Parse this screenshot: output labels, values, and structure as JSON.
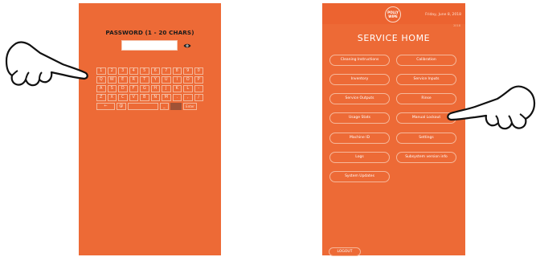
{
  "left_screen": {
    "title": "PASSWORD (1 - 20 CHARS)",
    "password_value": "",
    "keyboard": {
      "row1": [
        "1",
        "2",
        "3",
        "4",
        "5",
        "6",
        "7",
        "8",
        "9",
        "0"
      ],
      "row2": [
        "Q",
        "W",
        "E",
        "R",
        "T",
        "Y",
        "U",
        "I",
        "O",
        "P"
      ],
      "row3": [
        "A",
        "S",
        "D",
        "F",
        "G",
        "H",
        "J",
        "K",
        "L",
        "-"
      ],
      "row4": [
        "Z",
        "X",
        "C",
        "V",
        "B",
        "N",
        "M",
        ".",
        ",",
        "/"
      ],
      "row5": {
        "back": "←",
        "at": "@",
        "space": "",
        "underscore": "_",
        "shift": "",
        "enter": "Enter"
      }
    }
  },
  "right_screen": {
    "logo_text": "POLLY WIPE",
    "date": "Friday, June 8, 2018",
    "tag": "2018",
    "title": "SERVICE HOME",
    "buttons": [
      "Cleaning Instructions",
      "Calibration",
      "Inventory",
      "Service Inputs",
      "Service Outputs",
      "Rinse",
      "Usage Stats",
      "Manual Lockout",
      "Machine ID",
      "Settings",
      "Logs",
      "Subsystem version info",
      "System Updates"
    ],
    "logout": "LOGOUT"
  },
  "colors": {
    "screen_bg": "#ed6a36",
    "status_bar": "#ec6330",
    "button_border": "#f6b799",
    "shift_key": "#a05236"
  },
  "icons": [
    "eye-icon",
    "pointing-hand-icon"
  ]
}
